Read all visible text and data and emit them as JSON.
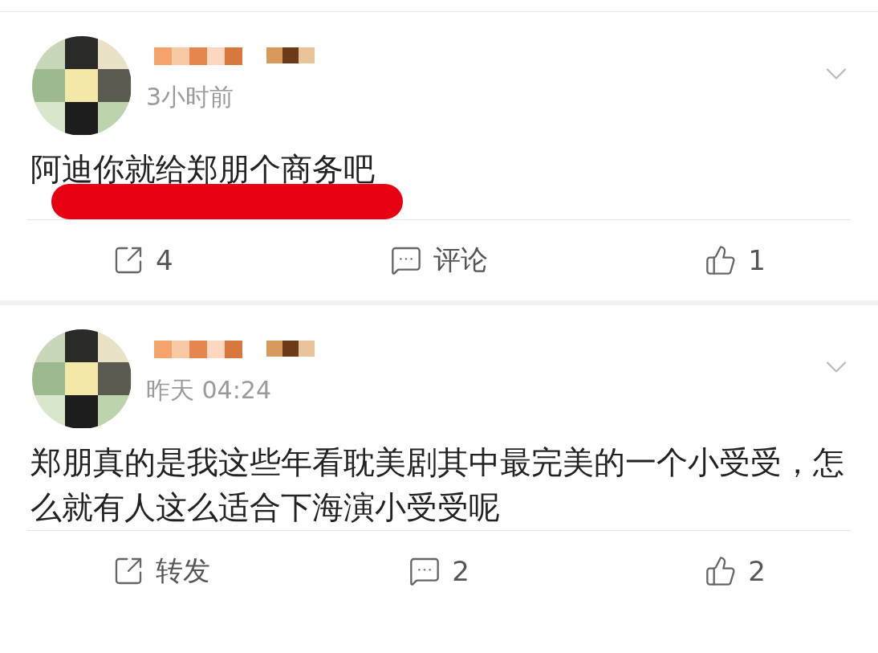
{
  "posts": [
    {
      "time": "3小时前",
      "text": "阿迪你就给郑朋个商务吧",
      "highlighted": true,
      "actions": [
        {
          "kind": "share",
          "label": "4"
        },
        {
          "kind": "comment",
          "label": "评论"
        },
        {
          "kind": "like",
          "label": "1"
        }
      ]
    },
    {
      "time": "昨天 04:24",
      "text": "郑朋真的是我这些年看耽美剧其中最完美的一个小受受，怎么就有人这么适合下海演小受受呢",
      "highlighted": false,
      "actions": [
        {
          "kind": "share",
          "label": "转发"
        },
        {
          "kind": "comment",
          "label": "2"
        },
        {
          "kind": "like",
          "label": "2"
        }
      ]
    }
  ]
}
